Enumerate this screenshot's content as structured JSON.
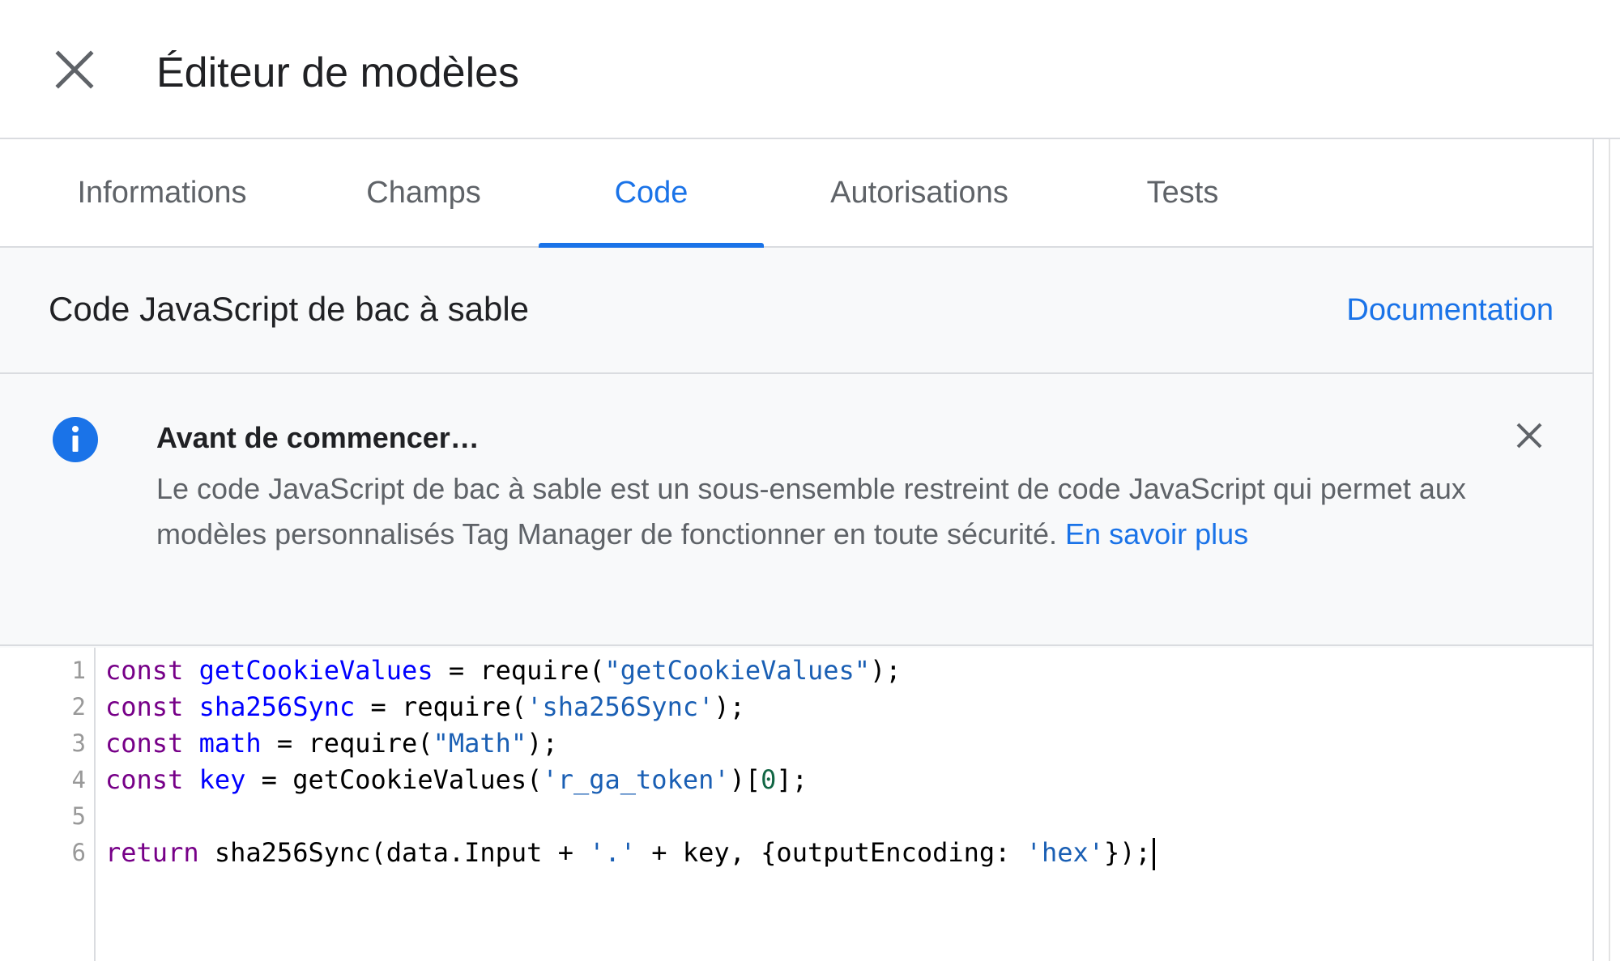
{
  "header": {
    "title": "Éditeur de modèles",
    "close_icon": "close-icon"
  },
  "tabs": [
    {
      "label": "Informations",
      "active": false
    },
    {
      "label": "Champs",
      "active": false
    },
    {
      "label": "Code",
      "active": true
    },
    {
      "label": "Autorisations",
      "active": false
    },
    {
      "label": "Tests",
      "active": false
    }
  ],
  "section": {
    "title": "Code JavaScript de bac à sable",
    "doc_link": "Documentation"
  },
  "notice": {
    "icon": "info-icon",
    "title": "Avant de commencer…",
    "body": "Le code JavaScript de bac à sable est un sous-ensemble restreint de code JavaScript qui permet aux modèles personnalisés Tag Manager de fonctionner en toute sécurité.",
    "link": "En savoir plus",
    "close_icon": "close-icon"
  },
  "editor": {
    "line_numbers": [
      "1",
      "2",
      "3",
      "4",
      "5",
      "6"
    ],
    "lines": [
      [
        {
          "t": "const",
          "c": "kw"
        },
        {
          "t": " "
        },
        {
          "t": "getCookieValues",
          "c": "def"
        },
        {
          "t": " = require("
        },
        {
          "t": "\"getCookieValues\"",
          "c": "str2"
        },
        {
          "t": ");"
        }
      ],
      [
        {
          "t": "const",
          "c": "kw"
        },
        {
          "t": " "
        },
        {
          "t": "sha256Sync",
          "c": "def"
        },
        {
          "t": " = require("
        },
        {
          "t": "'sha256Sync'",
          "c": "str2"
        },
        {
          "t": ");"
        }
      ],
      [
        {
          "t": "const",
          "c": "kw"
        },
        {
          "t": " "
        },
        {
          "t": "math",
          "c": "def"
        },
        {
          "t": " = require("
        },
        {
          "t": "\"Math\"",
          "c": "str2"
        },
        {
          "t": ");"
        }
      ],
      [
        {
          "t": "const",
          "c": "kw"
        },
        {
          "t": " "
        },
        {
          "t": "key",
          "c": "def"
        },
        {
          "t": " = getCookieValues("
        },
        {
          "t": "'r_ga_token'",
          "c": "str2"
        },
        {
          "t": ")["
        },
        {
          "t": "0",
          "c": "num"
        },
        {
          "t": "];"
        }
      ],
      [],
      [
        {
          "t": "return",
          "c": "kw"
        },
        {
          "t": " sha256Sync(data.Input + "
        },
        {
          "t": "'.'",
          "c": "str2"
        },
        {
          "t": " + key, {outputEncoding: "
        },
        {
          "t": "'hex'",
          "c": "str2"
        },
        {
          "t": "});"
        }
      ]
    ]
  },
  "colors": {
    "accent": "#1a73e8",
    "keyword": "#770088",
    "definition": "#0000ff",
    "string": "#1a5fb4",
    "number": "#116644"
  }
}
